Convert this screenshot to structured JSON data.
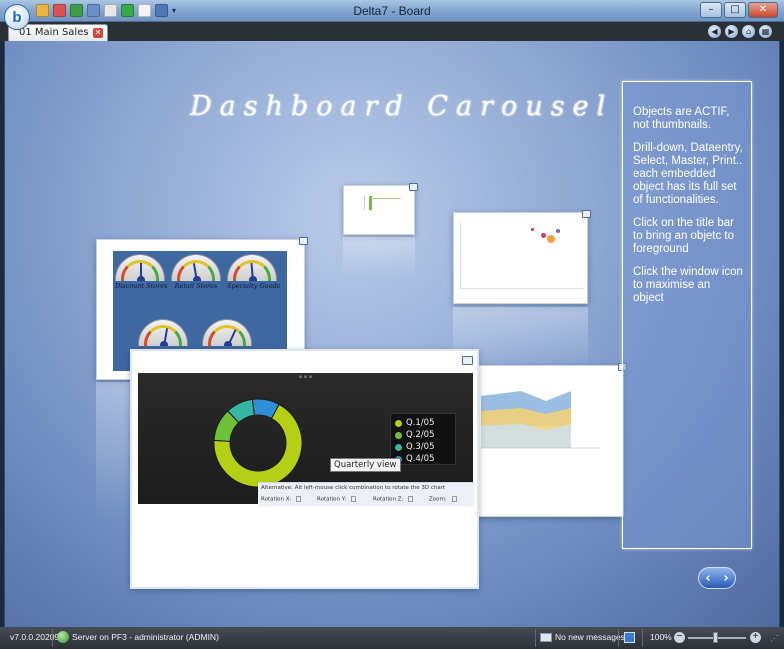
{
  "window": {
    "title": "Delta7 - Board",
    "app_logo": "b"
  },
  "quick_access": [
    "folder-icon",
    "undo-icon",
    "redo-icon",
    "save-icon",
    "print-icon",
    "refresh-icon",
    "chart-icon",
    "layout-icon",
    "dropdown-icon"
  ],
  "window_controls": {
    "minimize": "–",
    "maximize": "□",
    "close": "✕"
  },
  "tabs": [
    {
      "label": "01 Main Sales",
      "close": "✕"
    }
  ],
  "nav_icons": [
    "back-icon",
    "forward-icon",
    "home-icon",
    "grid-icon"
  ],
  "canvas": {
    "title": "Dashboard Carousel",
    "info": [
      "Objects are ACTIF, not thumbnails.",
      "Drill-down, Dataentry, Select, Master, Print.. each embedded object has its full set of functionalities.",
      "Click on the title bar to bring an objetc to foreground",
      "Click the window icon to maximise an object"
    ],
    "gauges": [
      {
        "label": "Discount Stores",
        "level": 0.55
      },
      {
        "label": "Retail Stores",
        "level": 0.45
      },
      {
        "label": "Specialty Goods",
        "level": 0.5
      },
      {
        "label": "",
        "level": 0.6
      },
      {
        "label": "",
        "level": 0.7
      }
    ],
    "donut_chart": {
      "tooltip": "Quarterly view",
      "hint": "Alternative: Alt left-mouse click combination to rotate the 3D chart",
      "controls": [
        "Rotation X:",
        "Rotation Y:",
        "Rotation Z:",
        "Zoom:"
      ],
      "colors": {
        "Q1": "#b5cf14",
        "Q2": "#6fc13a",
        "Q3": "#37b7a3",
        "Q4": "#2f8fd6"
      }
    },
    "nav": {
      "prev": "‹",
      "next": "›"
    }
  },
  "chart_data": {
    "type": "pie",
    "categories": [
      "Q.1/05",
      "Q.2/05",
      "Q.3/05",
      "Q.4/05"
    ],
    "values": [
      68,
      12,
      10,
      10
    ]
  },
  "status": {
    "version": "v7.0.0.20209",
    "server": "Server on PF3 - administrator (ADMIN)",
    "messages": "No new messages",
    "zoom": "100%",
    "zoom_minus": "−",
    "zoom_plus": "+"
  }
}
